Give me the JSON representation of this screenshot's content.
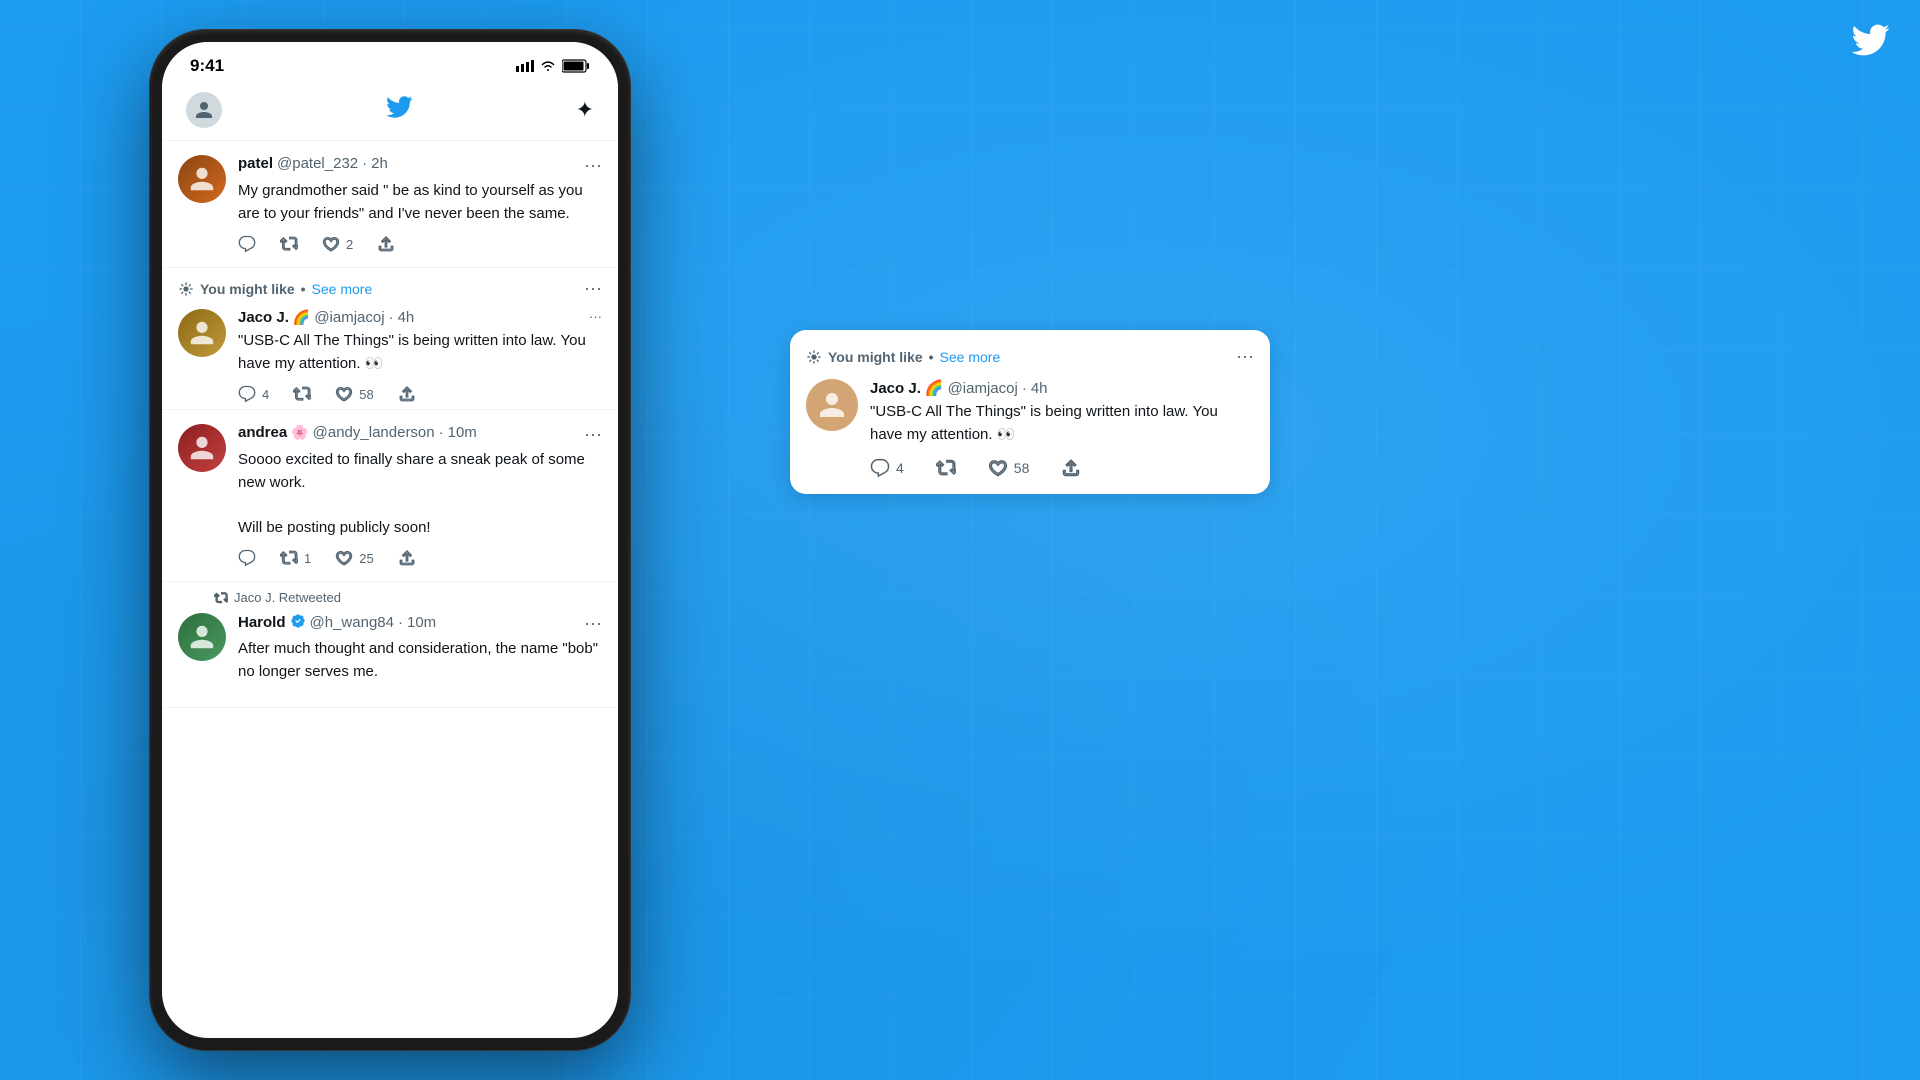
{
  "background": {
    "color": "#1d9bf0"
  },
  "corner_logo": "🐦",
  "status_bar": {
    "time": "9:41",
    "signal": "▐▐▐",
    "wifi": "WiFi",
    "battery": "🔋"
  },
  "nav": {
    "twitter_bird": "🐦",
    "sparkle": "✦"
  },
  "tweets": [
    {
      "id": "tweet-patel",
      "name": "patel",
      "handle": "@patel_232",
      "time": "2h",
      "text": "My grandmother said \" be as kind to yourself as you are to your friends\" and I've never been the same.",
      "replies": "",
      "retweets": "",
      "likes": "2",
      "avatar_emoji": "👤"
    }
  ],
  "you_might_like_section": {
    "pin_icon": "📍",
    "label": "You might like",
    "bullet": "•",
    "see_more": "See more",
    "more_icon": "···",
    "tweet": {
      "name": "Jaco J.",
      "emoji": "🌈",
      "handle": "@iamjacoj",
      "time": "4h",
      "text": "\"USB-C All The Things\" is being written into law. You have my attention. 👀",
      "replies": "4",
      "retweets": "",
      "likes": "58",
      "avatar_emoji": "😊"
    }
  },
  "andrea_tweet": {
    "name": "andrea",
    "emoji": "🌸",
    "handle": "@andy_landerson",
    "time": "10m",
    "text": "Soooo excited to finally share a sneak peak of some new work.\n\nWill be posting publicly soon!",
    "replies": "",
    "retweets": "1",
    "likes": "25",
    "avatar_emoji": "👩"
  },
  "harold_tweet": {
    "retweet_label": "Jaco J. Retweeted",
    "name": "Harold",
    "verified": "✓",
    "handle": "@h_wang84",
    "time": "10m",
    "text": "After much thought and consideration, the name \"bob\" no longer serves me.",
    "avatar_emoji": "👨"
  },
  "standalone_card": {
    "pin_icon": "📍",
    "label": "You might like",
    "bullet": "•",
    "see_more": "See more",
    "more_icon": "···",
    "tweet": {
      "name": "Jaco J.",
      "emoji": "🌈",
      "handle": "@iamjacoj",
      "time": "4h",
      "text": "\"USB-C All The Things\" is being written into law. You have my attention. 👀",
      "replies": "4",
      "retweets": "",
      "likes": "58",
      "avatar_emoji": "😊"
    }
  }
}
